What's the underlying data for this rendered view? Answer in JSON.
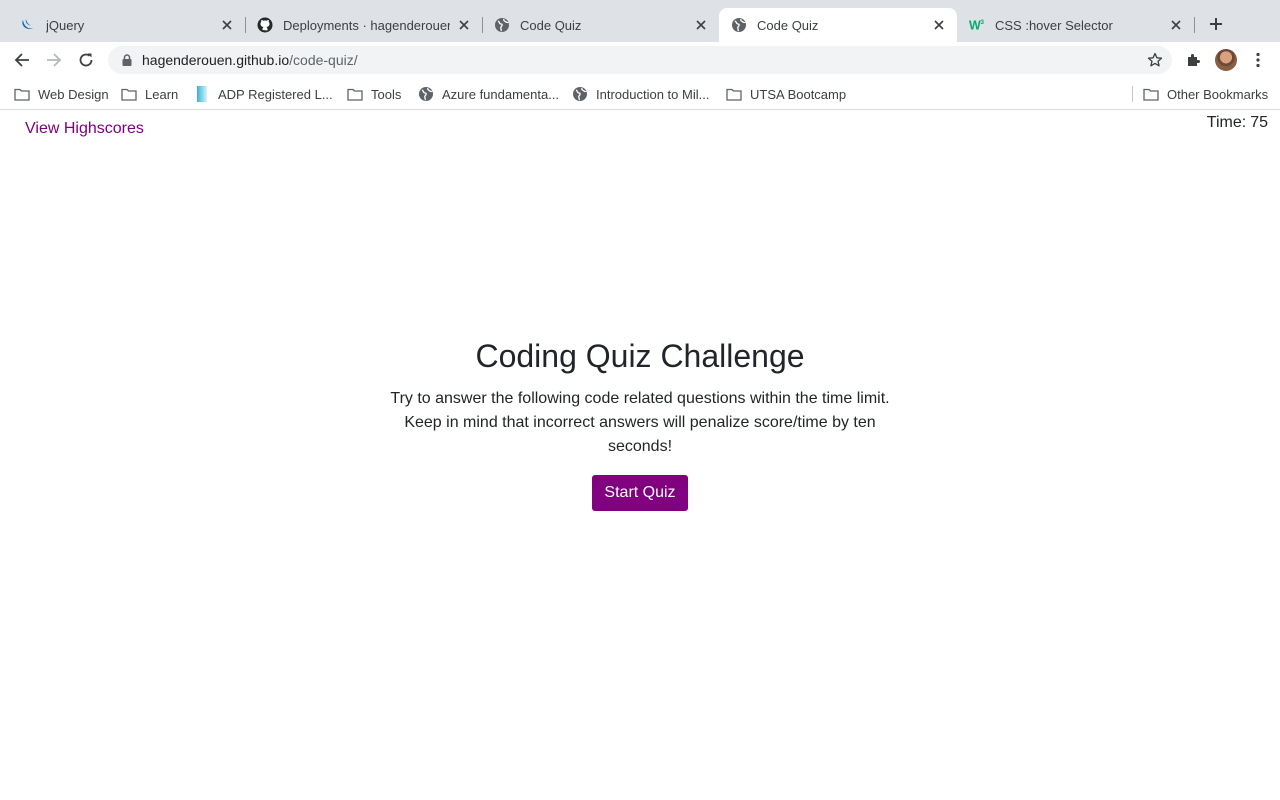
{
  "browser": {
    "tabs": [
      {
        "title": "jQuery",
        "icon": "jquery-icon",
        "active": false
      },
      {
        "title": "Deployments · hagenderouen/c",
        "icon": "github-icon",
        "active": false
      },
      {
        "title": "Code Quiz",
        "icon": "globe-icon",
        "active": false
      },
      {
        "title": "Code Quiz",
        "icon": "globe-icon",
        "active": true
      },
      {
        "title": "CSS :hover Selector",
        "icon": "w3schools-icon",
        "active": false
      }
    ],
    "address": {
      "host": "hagenderouen.github.io",
      "path": "/code-quiz/"
    },
    "bookmarks": [
      {
        "label": "Web Design",
        "icon": "folder-icon"
      },
      {
        "label": "Learn",
        "icon": "folder-icon"
      },
      {
        "label": "ADP Registered L...",
        "icon": "adp-icon"
      },
      {
        "label": "Tools",
        "icon": "folder-icon"
      },
      {
        "label": "Azure fundamenta...",
        "icon": "globe-icon"
      },
      {
        "label": "Introduction to Mil...",
        "icon": "globe-icon"
      },
      {
        "label": "UTSA Bootcamp",
        "icon": "folder-icon"
      }
    ],
    "other_bookmarks": "Other Bookmarks"
  },
  "page": {
    "highscores_link": "View Highscores",
    "timer": {
      "label": "Time:",
      "value": "75"
    },
    "title": "Coding Quiz Challenge",
    "description": "Try to answer the following code related questions within the time limit. Keep in mind that incorrect answers will penalize score/time by ten seconds!",
    "start_button": "Start Quiz",
    "accent_color": "#800080"
  }
}
